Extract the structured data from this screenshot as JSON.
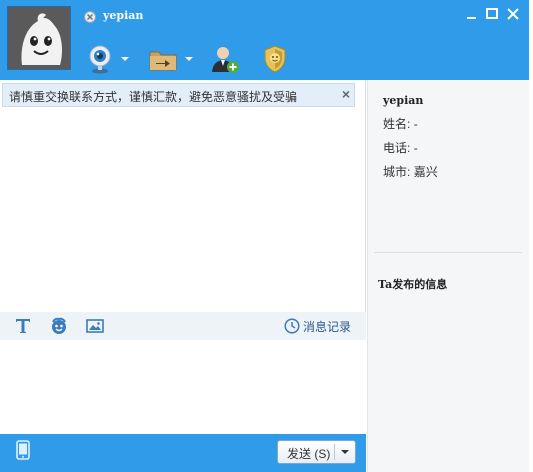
{
  "header": {
    "contact_name": "yepian",
    "icons": [
      "avatar-face",
      "status-offline-icon",
      "webcam-icon",
      "file-transfer-icon",
      "add-contact-icon",
      "security-shield-icon"
    ],
    "window_buttons": [
      "minimize-icon",
      "maximize-icon",
      "close-icon"
    ]
  },
  "chat": {
    "notice_text": "请慎重交换联系方式，谨慎汇款，避免恶意骚扰及受骗",
    "notice_close": "×",
    "toolbar": {
      "icons": [
        "font-icon",
        "emoji-icon",
        "image-icon"
      ],
      "history_label": "消息记录"
    }
  },
  "footer": {
    "send_label": "发送 (S)"
  },
  "profile": {
    "name": "yepian",
    "fields": [
      {
        "label": "姓名:",
        "value": "-"
      },
      {
        "label": "电话:",
        "value": "-"
      },
      {
        "label": "城市:",
        "value": "嘉兴"
      }
    ],
    "posts_heading": "Ta发布的信息"
  },
  "colors": {
    "brand_blue": "#2f9be9",
    "panel_gray": "#f5f6f7",
    "notice_bg": "#e3eef8"
  }
}
